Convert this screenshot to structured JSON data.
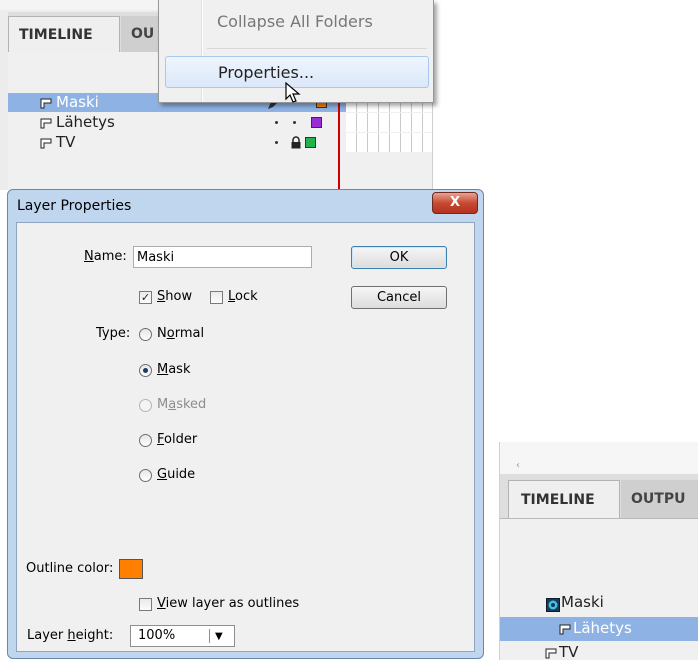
{
  "timeline_top": {
    "tab_active": "TIMELINE",
    "tab_inactive": "OU",
    "layers": [
      {
        "name": "Maski",
        "selected": true,
        "color": "#ff8000"
      },
      {
        "name": "Lähetys",
        "selected": false,
        "color": "#9b2bd6"
      },
      {
        "name": "TV",
        "selected": false,
        "color": "#22b14c"
      }
    ]
  },
  "context_menu": {
    "items": [
      {
        "label": "Collapse All Folders"
      },
      {
        "label": "Properties..."
      }
    ]
  },
  "dialog": {
    "title": "Layer Properties",
    "close_label": "X",
    "name_label": "Name:",
    "name_value": "Maski",
    "ok_label": "OK",
    "cancel_label": "Cancel",
    "show_label": "Show",
    "show_checked": true,
    "lock_label": "Lock",
    "lock_checked": false,
    "type_label": "Type:",
    "type_options": [
      {
        "label": "Normal",
        "checked": false,
        "disabled": false
      },
      {
        "label": "Mask",
        "checked": true,
        "disabled": false
      },
      {
        "label": "Masked",
        "checked": false,
        "disabled": true
      },
      {
        "label": "Folder",
        "checked": false,
        "disabled": false
      },
      {
        "label": "Guide",
        "checked": false,
        "disabled": false
      }
    ],
    "outline_color_label": "Outline color:",
    "outline_color": "#ff8000",
    "view_outlines_label": "View layer as outlines",
    "view_outlines_checked": false,
    "layer_height_label": "Layer height:",
    "layer_height_value": "100%"
  },
  "timeline_bottom": {
    "tab_active": "TIMELINE",
    "tab_inactive": "OUTPU",
    "layers": [
      {
        "name": "Maski",
        "selected": false,
        "icon": "mask-layer-icon"
      },
      {
        "name": "Lähetys",
        "selected": true,
        "icon": "layer-icon"
      },
      {
        "name": "TV",
        "selected": false,
        "icon": "layer-icon"
      }
    ]
  }
}
